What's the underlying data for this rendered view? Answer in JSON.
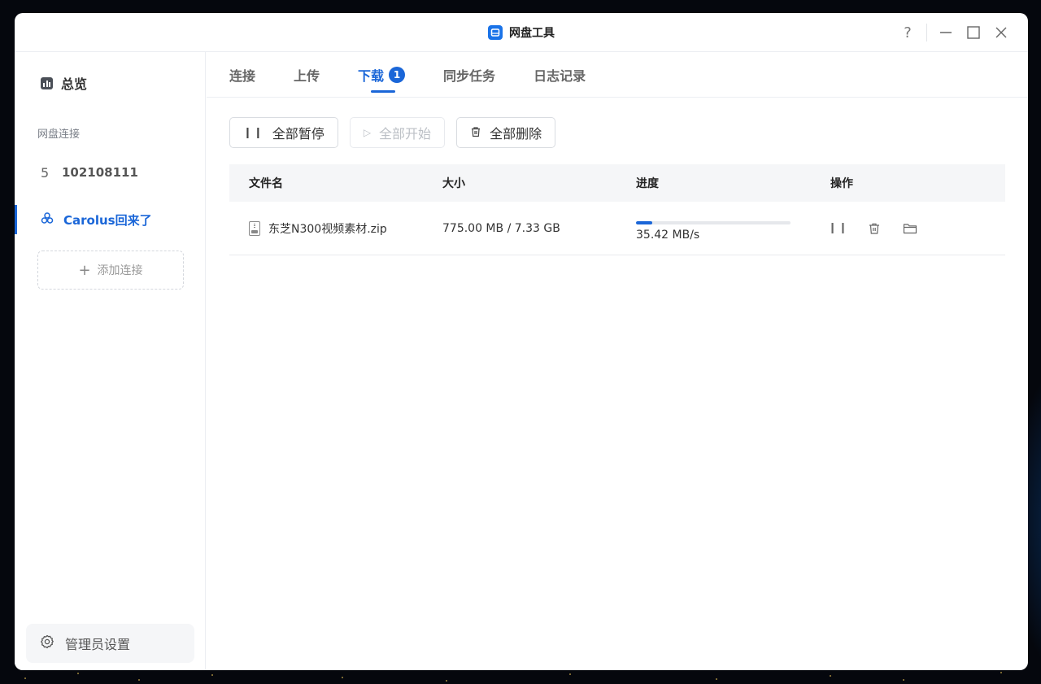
{
  "window": {
    "title": "网盘工具",
    "help_label": "?"
  },
  "sidebar": {
    "overview_label": "总览",
    "section_label": "网盘连接",
    "connections": [
      {
        "label": "102108111",
        "icon": "number-5-icon",
        "active": false
      },
      {
        "label": "Carolus回来了",
        "icon": "cloud-link-icon",
        "active": true
      }
    ],
    "add_connection_label": "添加连接",
    "admin_label": "管理员设置"
  },
  "tabs": [
    {
      "label": "连接",
      "active": false
    },
    {
      "label": "上传",
      "active": false
    },
    {
      "label": "下载",
      "active": true,
      "badge": "1"
    },
    {
      "label": "同步任务",
      "active": false
    },
    {
      "label": "日志记录",
      "active": false
    }
  ],
  "toolbar": {
    "pause_all": "全部暂停",
    "start_all": "全部开始",
    "delete_all": "全部删除"
  },
  "table": {
    "columns": [
      "文件名",
      "大小",
      "进度",
      "操作"
    ],
    "rows": [
      {
        "filename": "东芝N300视频素材.zip",
        "size": "775.00 MB / 7.33 GB",
        "progress_fraction": 0.103,
        "speed": "35.42 MB/s"
      }
    ]
  },
  "colors": {
    "accent": "#1a66d8",
    "text": "#333333",
    "muted": "#7a7f88"
  }
}
